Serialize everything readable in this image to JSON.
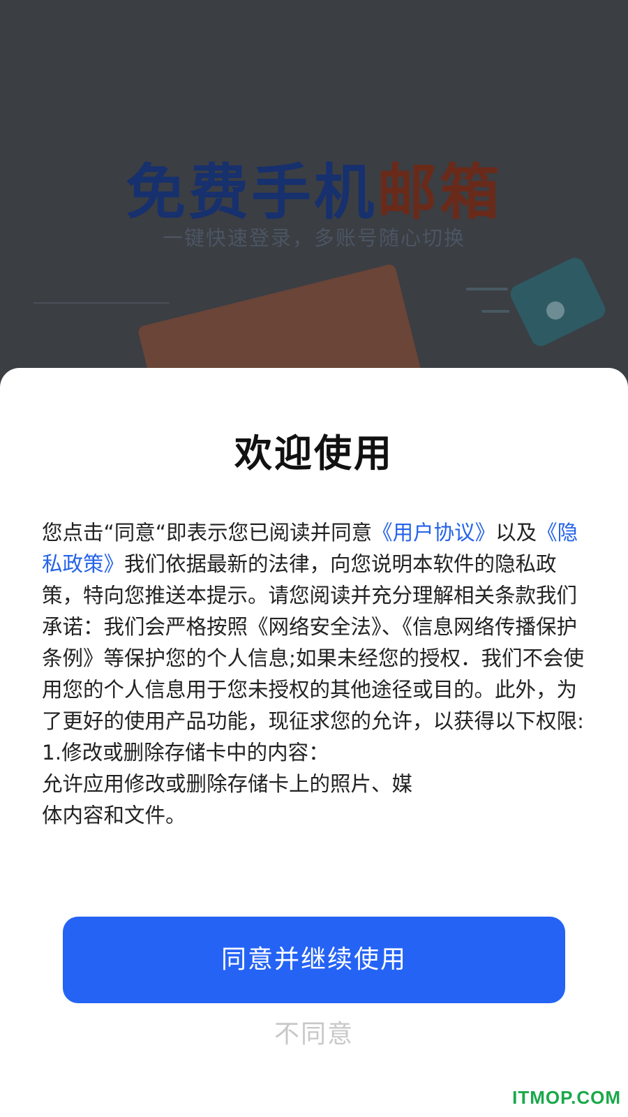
{
  "background": {
    "title_part1": "免费手机",
    "title_part2": "邮箱",
    "subtitle": "一键快速登录，多账号随心切换"
  },
  "dialog": {
    "title": "欢迎使用",
    "terms": {
      "intro": "您点击“同意“即表示您已阅读并同意",
      "link_user_agreement": "《用户协议》",
      "and": "以及",
      "link_privacy_policy": "《隐私政策》",
      "body": "我们依据最新的法律，向您说明本软件的隐私政策，特向您推送本提示。请您阅读并充分理解相关条款我们承诺：我们会严格按照《网络安全法》、《信息网络传播保护条例》等保护您的个人信息;如果未经您的授权．我们不会使用您的个人信息用于您未授权的其他途径或目的。此外，为了更好的使用产品功能，现征求您的允许，以获得以下权限:",
      "permission_1_title": "1.修改或删除存储卡中的内容：",
      "permission_1_desc": "允许应用修改或删除存储卡上的照片、媒体内容和文件。"
    },
    "agree_button": "同意并继续使用",
    "disagree_button": "不同意"
  },
  "watermark": "ITMOP.COM",
  "colors": {
    "primary": "#2563f5",
    "link": "#2563e8",
    "disagree": "#c8c8c8",
    "watermark": "#1aa84a"
  }
}
